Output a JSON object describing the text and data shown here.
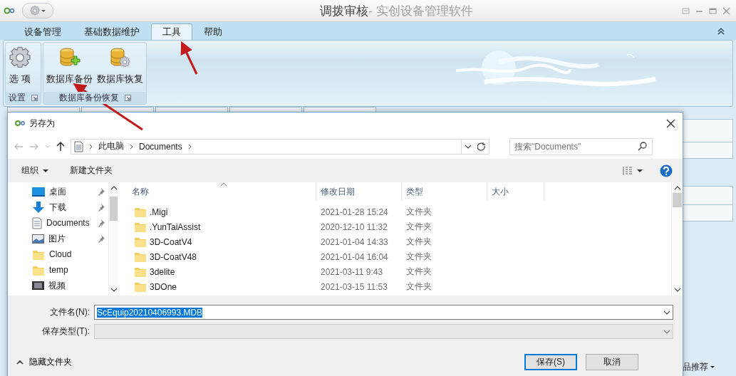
{
  "app": {
    "title": "调拨审核",
    "title_suffix": " - 实创设备管理软件"
  },
  "ribbon_tabs": [
    {
      "label": "设备管理",
      "selected": false
    },
    {
      "label": "基础数据维护",
      "selected": false
    },
    {
      "label": "工具",
      "selected": true
    },
    {
      "label": "帮助",
      "selected": false
    }
  ],
  "ribbon_groups": [
    {
      "label": "设置",
      "buttons": [
        {
          "label": "选 项",
          "kind": "gear"
        }
      ]
    },
    {
      "label": "数据库备份恢复",
      "buttons": [
        {
          "label": "数据库备份",
          "kind": "db-add"
        },
        {
          "label": "数据库恢复",
          "kind": "db-gear"
        }
      ]
    }
  ],
  "status_text": "品推荐",
  "dialog": {
    "title": "另存为",
    "breadcrumb": [
      "此电脑",
      "Documents"
    ],
    "search": {
      "placeholder": "搜索\"Documents\""
    },
    "toolbar": [
      {
        "label": "组织",
        "kind": "menu"
      },
      {
        "label": "新建文件夹",
        "kind": "plain"
      }
    ],
    "sidebar": [
      {
        "label": "桌面",
        "kind": "desktop",
        "pinned": true
      },
      {
        "label": "下载",
        "kind": "download",
        "pinned": true
      },
      {
        "label": "Documents",
        "kind": "document",
        "pinned": true
      },
      {
        "label": "图片",
        "kind": "pictures",
        "pinned": true
      },
      {
        "label": "Cloud",
        "kind": "folder",
        "pinned": false
      },
      {
        "label": "temp",
        "kind": "folder",
        "pinned": false
      },
      {
        "label": "视频",
        "kind": "video",
        "pinned": false
      }
    ],
    "columns": [
      "名称",
      "修改日期",
      "类型",
      "大小"
    ],
    "files": [
      {
        "name": ".Migi",
        "modified": "2021-01-28 15:24",
        "type": "文件夹"
      },
      {
        "name": ".YunTaiAssist",
        "modified": "2020-12-10 11:32",
        "type": "文件夹"
      },
      {
        "name": "3D-CoatV4",
        "modified": "2021-01-04 14:33",
        "type": "文件夹"
      },
      {
        "name": "3D-CoatV48",
        "modified": "2021-01-04 16:04",
        "type": "文件夹"
      },
      {
        "name": "3delite",
        "modified": "2021-03-11 9:43",
        "type": "文件夹"
      },
      {
        "name": "3DOne",
        "modified": "2021-03-15 11:53",
        "type": "文件夹"
      }
    ],
    "filename": {
      "label": "文件名(N):",
      "value": "ScEquip20210406993.MDB",
      "value_selected": true
    },
    "filetype": {
      "label": "保存类型(T):"
    },
    "hide_folders": "隐藏文件夹",
    "buttons": [
      {
        "label": "保存(S)",
        "kind": "primary"
      },
      {
        "label": "取消",
        "kind": "normal"
      }
    ]
  }
}
